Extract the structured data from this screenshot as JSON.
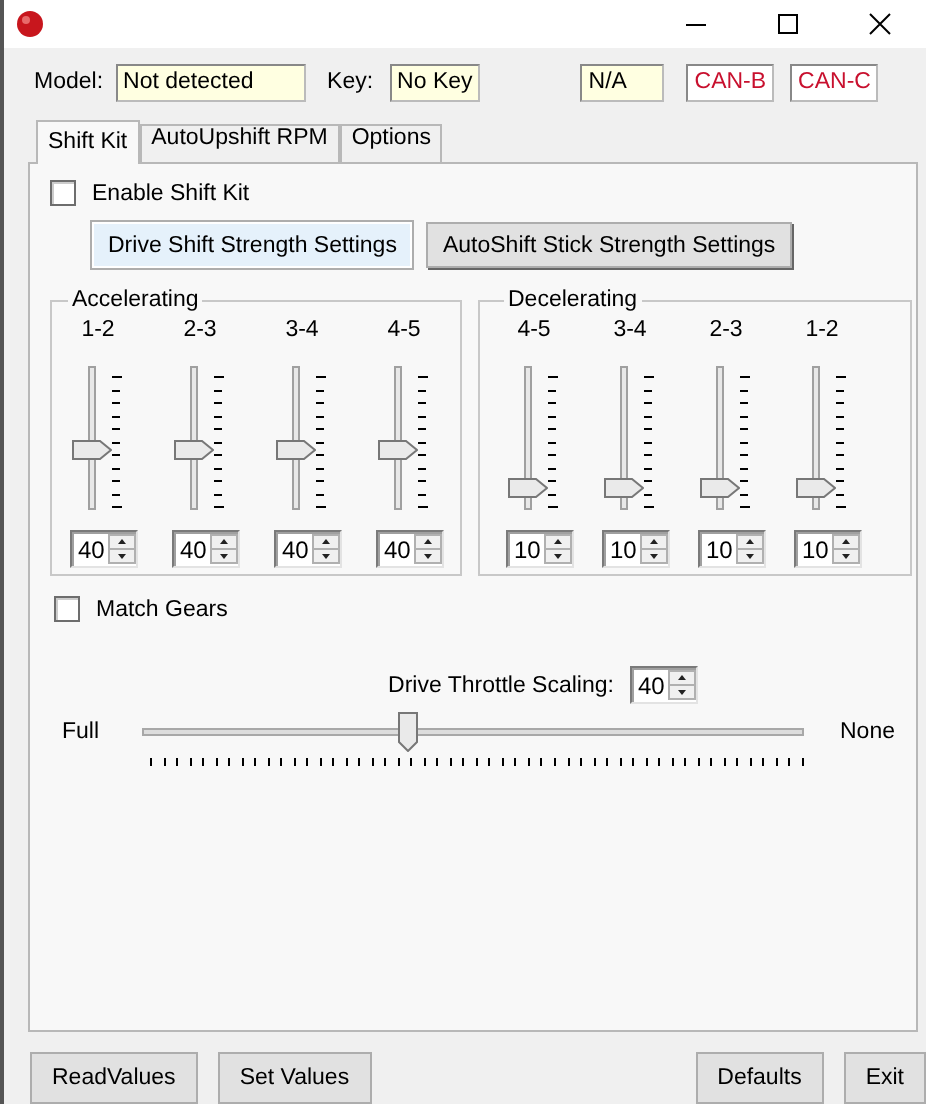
{
  "header": {
    "model_label": "Model:",
    "model_value": "Not detected",
    "key_label": "Key:",
    "key_value": "No Key",
    "status_fields": [
      {
        "value": "N/A",
        "kind": "info"
      },
      {
        "value": "CAN-B",
        "kind": "alert"
      },
      {
        "value": "CAN-C",
        "kind": "alert"
      }
    ]
  },
  "tabs": [
    {
      "label": "Shift Kit",
      "selected": true
    },
    {
      "label": "AutoUpshift RPM",
      "selected": false
    },
    {
      "label": "Options",
      "selected": false
    }
  ],
  "enable_shift_kit": {
    "label": "Enable Shift Kit",
    "checked": false
  },
  "mode_buttons": [
    {
      "label": "Drive Shift Strength Settings",
      "selected": true
    },
    {
      "label": "AutoShift Stick Strength Settings",
      "selected": false
    }
  ],
  "groups": [
    {
      "title": "Accelerating",
      "sliders": [
        {
          "label": "1-2",
          "level": 0.4,
          "value": "40"
        },
        {
          "label": "2-3",
          "level": 0.4,
          "value": "40"
        },
        {
          "label": "3-4",
          "level": 0.4,
          "value": "40"
        },
        {
          "label": "4-5",
          "level": 0.4,
          "value": "40"
        }
      ]
    },
    {
      "title": "Decelerating",
      "sliders": [
        {
          "label": "4-5",
          "level": 0.1,
          "value": "10"
        },
        {
          "label": "3-4",
          "level": 0.1,
          "value": "10"
        },
        {
          "label": "2-3",
          "level": 0.1,
          "value": "10"
        },
        {
          "label": "1-2",
          "level": 0.1,
          "value": "10"
        }
      ]
    }
  ],
  "match_gears": {
    "label": "Match Gears",
    "checked": false
  },
  "throttle": {
    "label": "Drive Throttle Scaling:",
    "value": "40",
    "min_label": "Full",
    "max_label": "None",
    "level": 0.4
  },
  "footer_buttons": [
    "ReadValues",
    "Set Values",
    "Defaults",
    "Exit"
  ]
}
